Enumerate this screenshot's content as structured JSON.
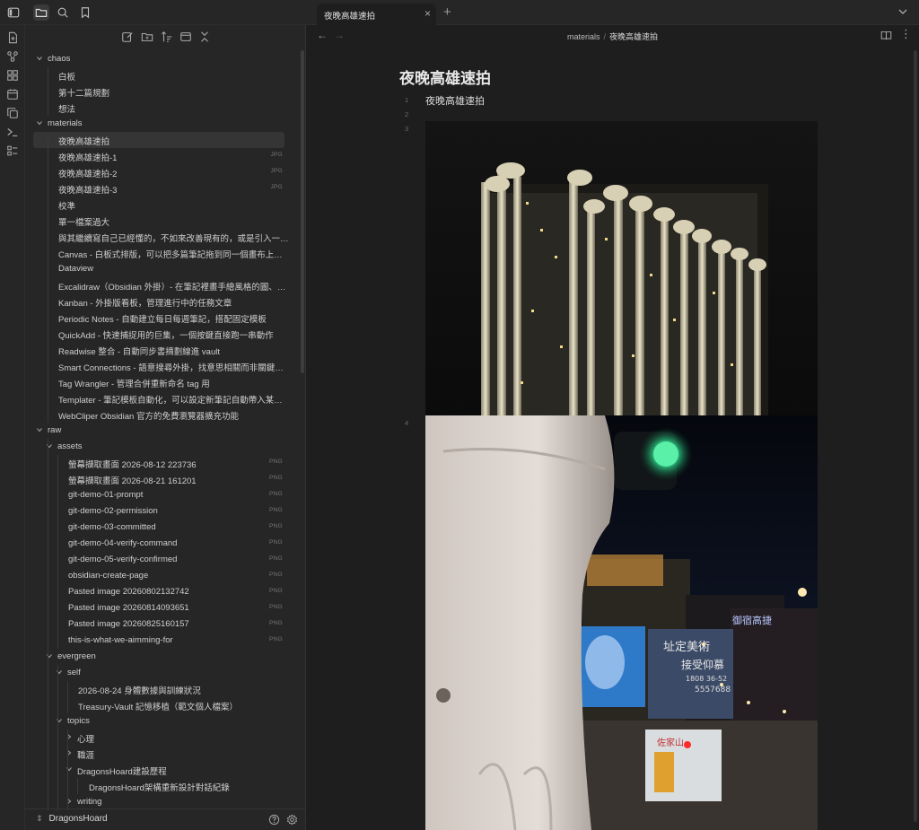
{
  "tab": {
    "title": "夜晚高雄速拍"
  },
  "breadcrumb": {
    "folder": "materials",
    "sep": "/",
    "file": "夜晚高雄速拍"
  },
  "note": {
    "title": "夜晚高雄速拍",
    "line1_text": "夜晚高雄速拍",
    "line_numbers": [
      "1",
      "2",
      "3",
      "4"
    ]
  },
  "vault": {
    "name": "DragonsHoard"
  },
  "tree": [
    {
      "label": "chaos",
      "depth": 0,
      "type": "folder"
    },
    {
      "label": "白板",
      "depth": 1,
      "type": "file"
    },
    {
      "label": "第十二篇規劃",
      "depth": 1,
      "type": "file"
    },
    {
      "label": "想法",
      "depth": 1,
      "type": "file"
    },
    {
      "label": "materials",
      "depth": 0,
      "type": "folder"
    },
    {
      "label": "夜晚高雄速拍",
      "depth": 1,
      "type": "file",
      "selected": true
    },
    {
      "label": "夜晚高雄速拍-1",
      "depth": 1,
      "type": "file",
      "ext": "JPG"
    },
    {
      "label": "夜晚高雄速拍-2",
      "depth": 1,
      "type": "file",
      "ext": "JPG"
    },
    {
      "label": "夜晚高雄速拍-3",
      "depth": 1,
      "type": "file",
      "ext": "JPG"
    },
    {
      "label": "校準",
      "depth": 1,
      "type": "file"
    },
    {
      "label": "單一檔案過大",
      "depth": 1,
      "type": "file"
    },
    {
      "label": "與其繼續寫自己已經懂的，不如來改善現有的，或是引入一些新...",
      "depth": 1,
      "type": "file"
    },
    {
      "label": "Canvas - 白板式排版，可以把多篇筆記拖到同一個畫布上拼關聯",
      "depth": 1,
      "type": "file"
    },
    {
      "label": "Dataview",
      "depth": 1,
      "type": "file"
    },
    {
      "label": "Excalidraw（Obsidian 外掛）- 在筆記裡畫手繪風格的圖、流程...",
      "depth": 1,
      "type": "file"
    },
    {
      "label": "Kanban - 外掛版看板，管理進行中的任務文章",
      "depth": 1,
      "type": "file"
    },
    {
      "label": "Periodic Notes - 自動建立每日每週筆記，搭配固定模板",
      "depth": 1,
      "type": "file"
    },
    {
      "label": "QuickAdd - 快速捕捉用的巨集，一個按鍵直接跑一串動作",
      "depth": 1,
      "type": "file"
    },
    {
      "label": "Readwise 整合 - 自動同步書摘劃線進 vault",
      "depth": 1,
      "type": "file"
    },
    {
      "label": "Smart Connections - 語意搜尋外掛，找意思相關而非關鍵字相...",
      "depth": 1,
      "type": "file"
    },
    {
      "label": "Tag Wrangler - 管理合併重新命名 tag 用",
      "depth": 1,
      "type": "file"
    },
    {
      "label": "Templater - 筆記模板自動化，可以設定新筆記自動帶入某種格式",
      "depth": 1,
      "type": "file"
    },
    {
      "label": "WebCliper Obsidian 官方的免費瀏覽器擴充功能",
      "depth": 1,
      "type": "file"
    },
    {
      "label": "raw",
      "depth": 0,
      "type": "folder"
    },
    {
      "label": "assets",
      "depth": 1,
      "type": "folder"
    },
    {
      "label": "螢幕擷取畫面 2026-08-12 223736",
      "depth": 2,
      "type": "file",
      "ext": "PNG"
    },
    {
      "label": "螢幕擷取畫面 2026-08-21 161201",
      "depth": 2,
      "type": "file",
      "ext": "PNG"
    },
    {
      "label": "git-demo-01-prompt",
      "depth": 2,
      "type": "file",
      "ext": "PNG"
    },
    {
      "label": "git-demo-02-permission",
      "depth": 2,
      "type": "file",
      "ext": "PNG"
    },
    {
      "label": "git-demo-03-committed",
      "depth": 2,
      "type": "file",
      "ext": "PNG"
    },
    {
      "label": "git-demo-04-verify-command",
      "depth": 2,
      "type": "file",
      "ext": "PNG"
    },
    {
      "label": "git-demo-05-verify-confirmed",
      "depth": 2,
      "type": "file",
      "ext": "PNG"
    },
    {
      "label": "obsidian-create-page",
      "depth": 2,
      "type": "file",
      "ext": "PNG"
    },
    {
      "label": "Pasted image 20260802132742",
      "depth": 2,
      "type": "file",
      "ext": "PNG"
    },
    {
      "label": "Pasted image 20260814093651",
      "depth": 2,
      "type": "file",
      "ext": "PNG"
    },
    {
      "label": "Pasted image 20260825160157",
      "depth": 2,
      "type": "file",
      "ext": "PNG"
    },
    {
      "label": "this-is-what-we-aimming-for",
      "depth": 2,
      "type": "file",
      "ext": "PNG"
    },
    {
      "label": "evergreen",
      "depth": 1,
      "type": "folder"
    },
    {
      "label": "self",
      "depth": 2,
      "type": "folder"
    },
    {
      "label": "2026-08-24 身體數據與訓練狀況",
      "depth": 3,
      "type": "file"
    },
    {
      "label": "Treasury-Vault 記憶移植（範文個人檔案）",
      "depth": 3,
      "type": "file"
    },
    {
      "label": "topics",
      "depth": 2,
      "type": "folder"
    },
    {
      "label": "心理",
      "depth": 3,
      "type": "folder-collapsed"
    },
    {
      "label": "職涯",
      "depth": 3,
      "type": "folder-collapsed"
    },
    {
      "label": "DragonsHoard建設歷程",
      "depth": 3,
      "type": "folder"
    },
    {
      "label": "DragonsHoard架構重新設計對話紀錄",
      "depth": 4,
      "type": "file"
    },
    {
      "label": "writing",
      "depth": 3,
      "type": "folder-collapsed"
    }
  ],
  "images": [
    {
      "subject": "night-skyscraper"
    },
    {
      "subject": "traffic-light-city-night",
      "billboard_text_1": "址定美術",
      "billboard_text_2": "接受仰慕",
      "billboard_phone": "1808 36-52",
      "billboard_phone_2": "5557688",
      "sign_text": "御宿高捷",
      "store_text": "佐家山"
    }
  ]
}
